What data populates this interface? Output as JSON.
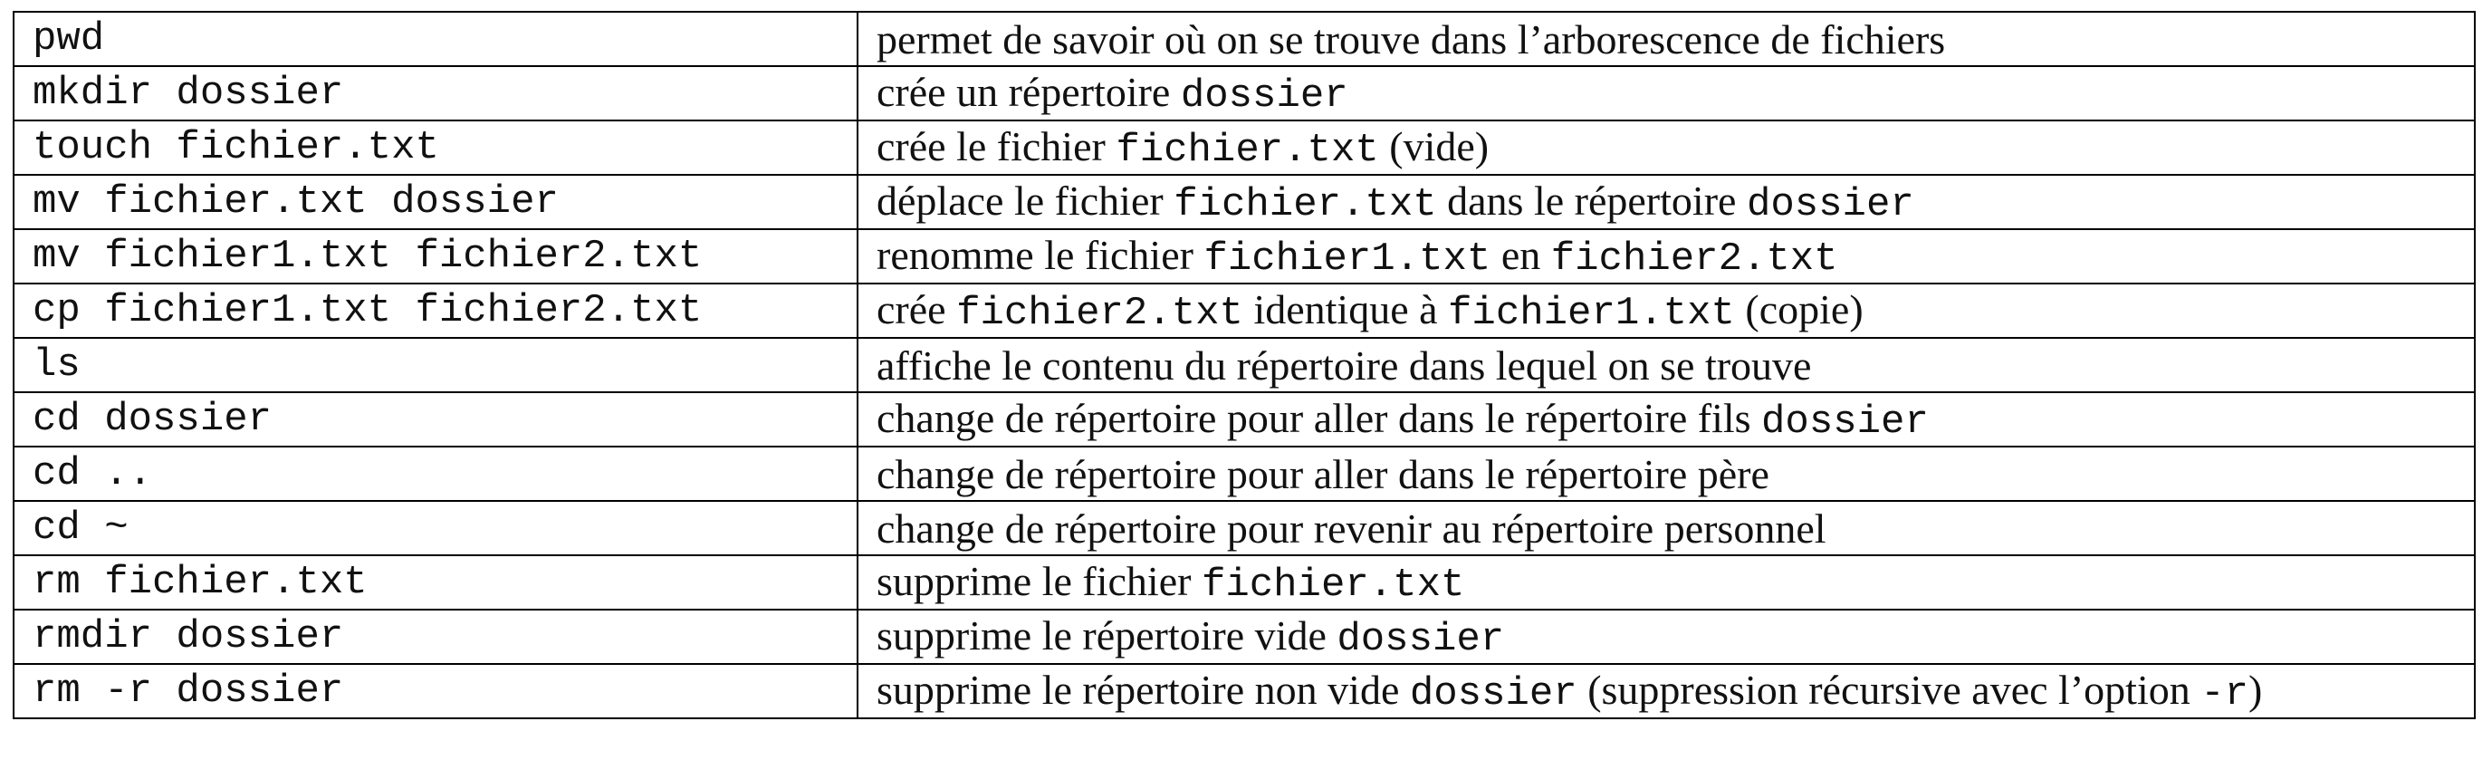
{
  "rows": [
    {
      "command": "pwd",
      "description": [
        {
          "t": "permet de savoir où on se trouve dans l’arborescence de fichiers"
        }
      ]
    },
    {
      "command": "mkdir dossier",
      "description": [
        {
          "t": "crée un répertoire "
        },
        {
          "t": "dossier",
          "code": true
        }
      ]
    },
    {
      "command": "touch fichier.txt",
      "description": [
        {
          "t": "crée le fichier "
        },
        {
          "t": "fichier.txt",
          "code": true
        },
        {
          "t": " (vide)"
        }
      ]
    },
    {
      "command": "mv fichier.txt dossier",
      "description": [
        {
          "t": "déplace le fichier "
        },
        {
          "t": "fichier.txt",
          "code": true
        },
        {
          "t": " dans le répertoire "
        },
        {
          "t": "dossier",
          "code": true
        }
      ]
    },
    {
      "command": "mv fichier1.txt fichier2.txt",
      "description": [
        {
          "t": "renomme le fichier "
        },
        {
          "t": "fichier1.txt",
          "code": true
        },
        {
          "t": " en "
        },
        {
          "t": "fichier2.txt",
          "code": true
        }
      ]
    },
    {
      "command": "cp fichier1.txt fichier2.txt",
      "description": [
        {
          "t": "crée "
        },
        {
          "t": "fichier2.txt",
          "code": true
        },
        {
          "t": " identique à "
        },
        {
          "t": "fichier1.txt",
          "code": true
        },
        {
          "t": " (copie)"
        }
      ]
    },
    {
      "command": "ls",
      "description": [
        {
          "t": "affiche le contenu du répertoire dans lequel on se trouve"
        }
      ]
    },
    {
      "command": "cd dossier",
      "description": [
        {
          "t": "change de répertoire pour aller dans le répertoire fils "
        },
        {
          "t": "dossier",
          "code": true
        }
      ]
    },
    {
      "command": "cd ..",
      "description": [
        {
          "t": "change de répertoire pour aller dans le répertoire père"
        }
      ]
    },
    {
      "command": "cd ~",
      "description": [
        {
          "t": "change de répertoire pour revenir au répertoire personnel"
        }
      ]
    },
    {
      "command": "rm fichier.txt",
      "description": [
        {
          "t": "supprime le fichier "
        },
        {
          "t": "fichier.txt",
          "code": true
        }
      ]
    },
    {
      "command": "rmdir dossier",
      "description": [
        {
          "t": "supprime le répertoire vide "
        },
        {
          "t": "dossier",
          "code": true
        }
      ]
    },
    {
      "command": "rm -r dossier",
      "description": [
        {
          "t": "supprime le répertoire non vide "
        },
        {
          "t": "dossier",
          "code": true
        },
        {
          "t": " (suppression récursive avec l’option "
        },
        {
          "t": "-r",
          "code": true
        },
        {
          "t": ")"
        }
      ]
    }
  ]
}
